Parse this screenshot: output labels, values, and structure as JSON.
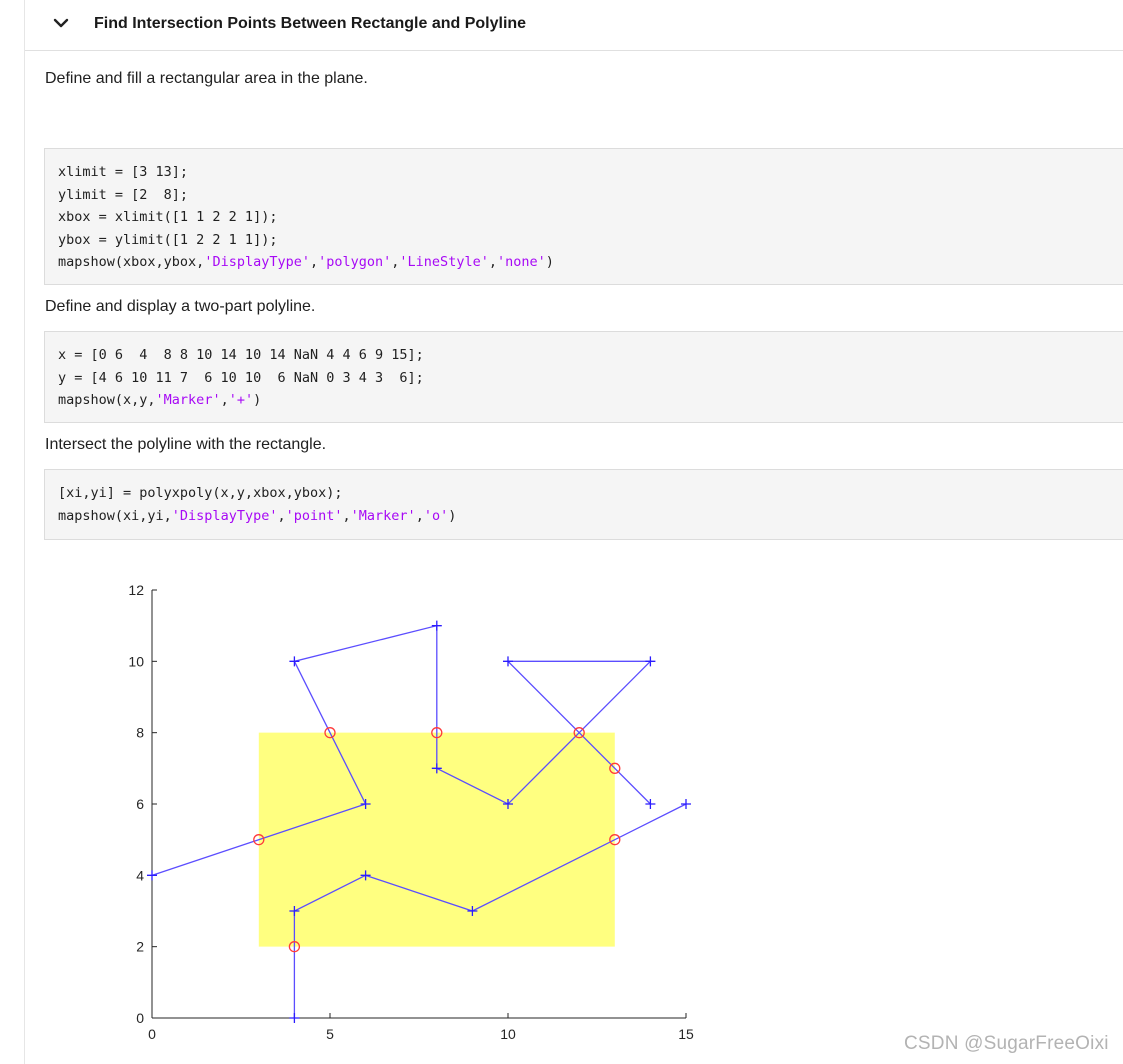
{
  "header": {
    "title": "Find Intersection Points Between Rectangle and Polyline"
  },
  "sections": {
    "p1": "Define and fill a rectangular area in the plane.",
    "p2": "Define and display a two-part polyline.",
    "p3": "Intersect the polyline with the rectangle."
  },
  "code1": [
    [
      {
        "t": "xlimit = [3 13];"
      }
    ],
    [
      {
        "t": "ylimit = [2  8];"
      }
    ],
    [
      {
        "t": "xbox = xlimit([1 1 2 2 1]);"
      }
    ],
    [
      {
        "t": "ybox = ylimit([1 2 2 1 1]);"
      }
    ],
    [
      {
        "t": "mapshow(xbox,ybox,"
      },
      {
        "t": "'DisplayType'",
        "s": true
      },
      {
        "t": ","
      },
      {
        "t": "'polygon'",
        "s": true
      },
      {
        "t": ","
      },
      {
        "t": "'LineStyle'",
        "s": true
      },
      {
        "t": ","
      },
      {
        "t": "'none'",
        "s": true
      },
      {
        "t": ")"
      }
    ]
  ],
  "code2": [
    [
      {
        "t": "x = [0 6  4  8 8 10 14 10 14 NaN 4 4 6 9 15];"
      }
    ],
    [
      {
        "t": "y = [4 6 10 11 7  6 10 10  6 NaN 0 3 4 3  6];"
      }
    ],
    [
      {
        "t": "mapshow(x,y,"
      },
      {
        "t": "'Marker'",
        "s": true
      },
      {
        "t": ","
      },
      {
        "t": "'+'",
        "s": true
      },
      {
        "t": ")"
      }
    ]
  ],
  "code3": [
    [
      {
        "t": "[xi,yi] = polyxpoly(x,y,xbox,ybox);"
      }
    ],
    [
      {
        "t": "mapshow(xi,yi,"
      },
      {
        "t": "'DisplayType'",
        "s": true
      },
      {
        "t": ","
      },
      {
        "t": "'point'",
        "s": true
      },
      {
        "t": ","
      },
      {
        "t": "'Marker'",
        "s": true
      },
      {
        "t": ","
      },
      {
        "t": "'o'",
        "s": true
      },
      {
        "t": ")"
      }
    ]
  ],
  "chart_data": {
    "type": "line",
    "xlim": [
      0,
      15
    ],
    "ylim": [
      0,
      12
    ],
    "xticks": [
      0,
      5,
      10,
      15
    ],
    "yticks": [
      0,
      2,
      4,
      6,
      8,
      10,
      12
    ],
    "rectangle": {
      "x": [
        3,
        3,
        13,
        13,
        3
      ],
      "y": [
        2,
        8,
        8,
        2,
        2
      ],
      "color": "#ffff80"
    },
    "polyline_parts": [
      {
        "x": [
          0,
          6,
          4,
          8,
          8,
          10,
          14,
          10,
          14
        ],
        "y": [
          4,
          6,
          10,
          11,
          7,
          6,
          10,
          10,
          6
        ]
      },
      {
        "x": [
          4,
          4,
          6,
          9,
          15
        ],
        "y": [
          0,
          3,
          4,
          3,
          6
        ]
      }
    ],
    "polyline_color": "#5b4dff",
    "intersections": {
      "x": [
        3,
        5,
        8,
        12,
        13,
        13,
        4
      ],
      "y": [
        5,
        8,
        8,
        8,
        7,
        5,
        2
      ]
    },
    "intersection_color": "#ff3b3b"
  },
  "watermark": "CSDN @SugarFreeOixi"
}
